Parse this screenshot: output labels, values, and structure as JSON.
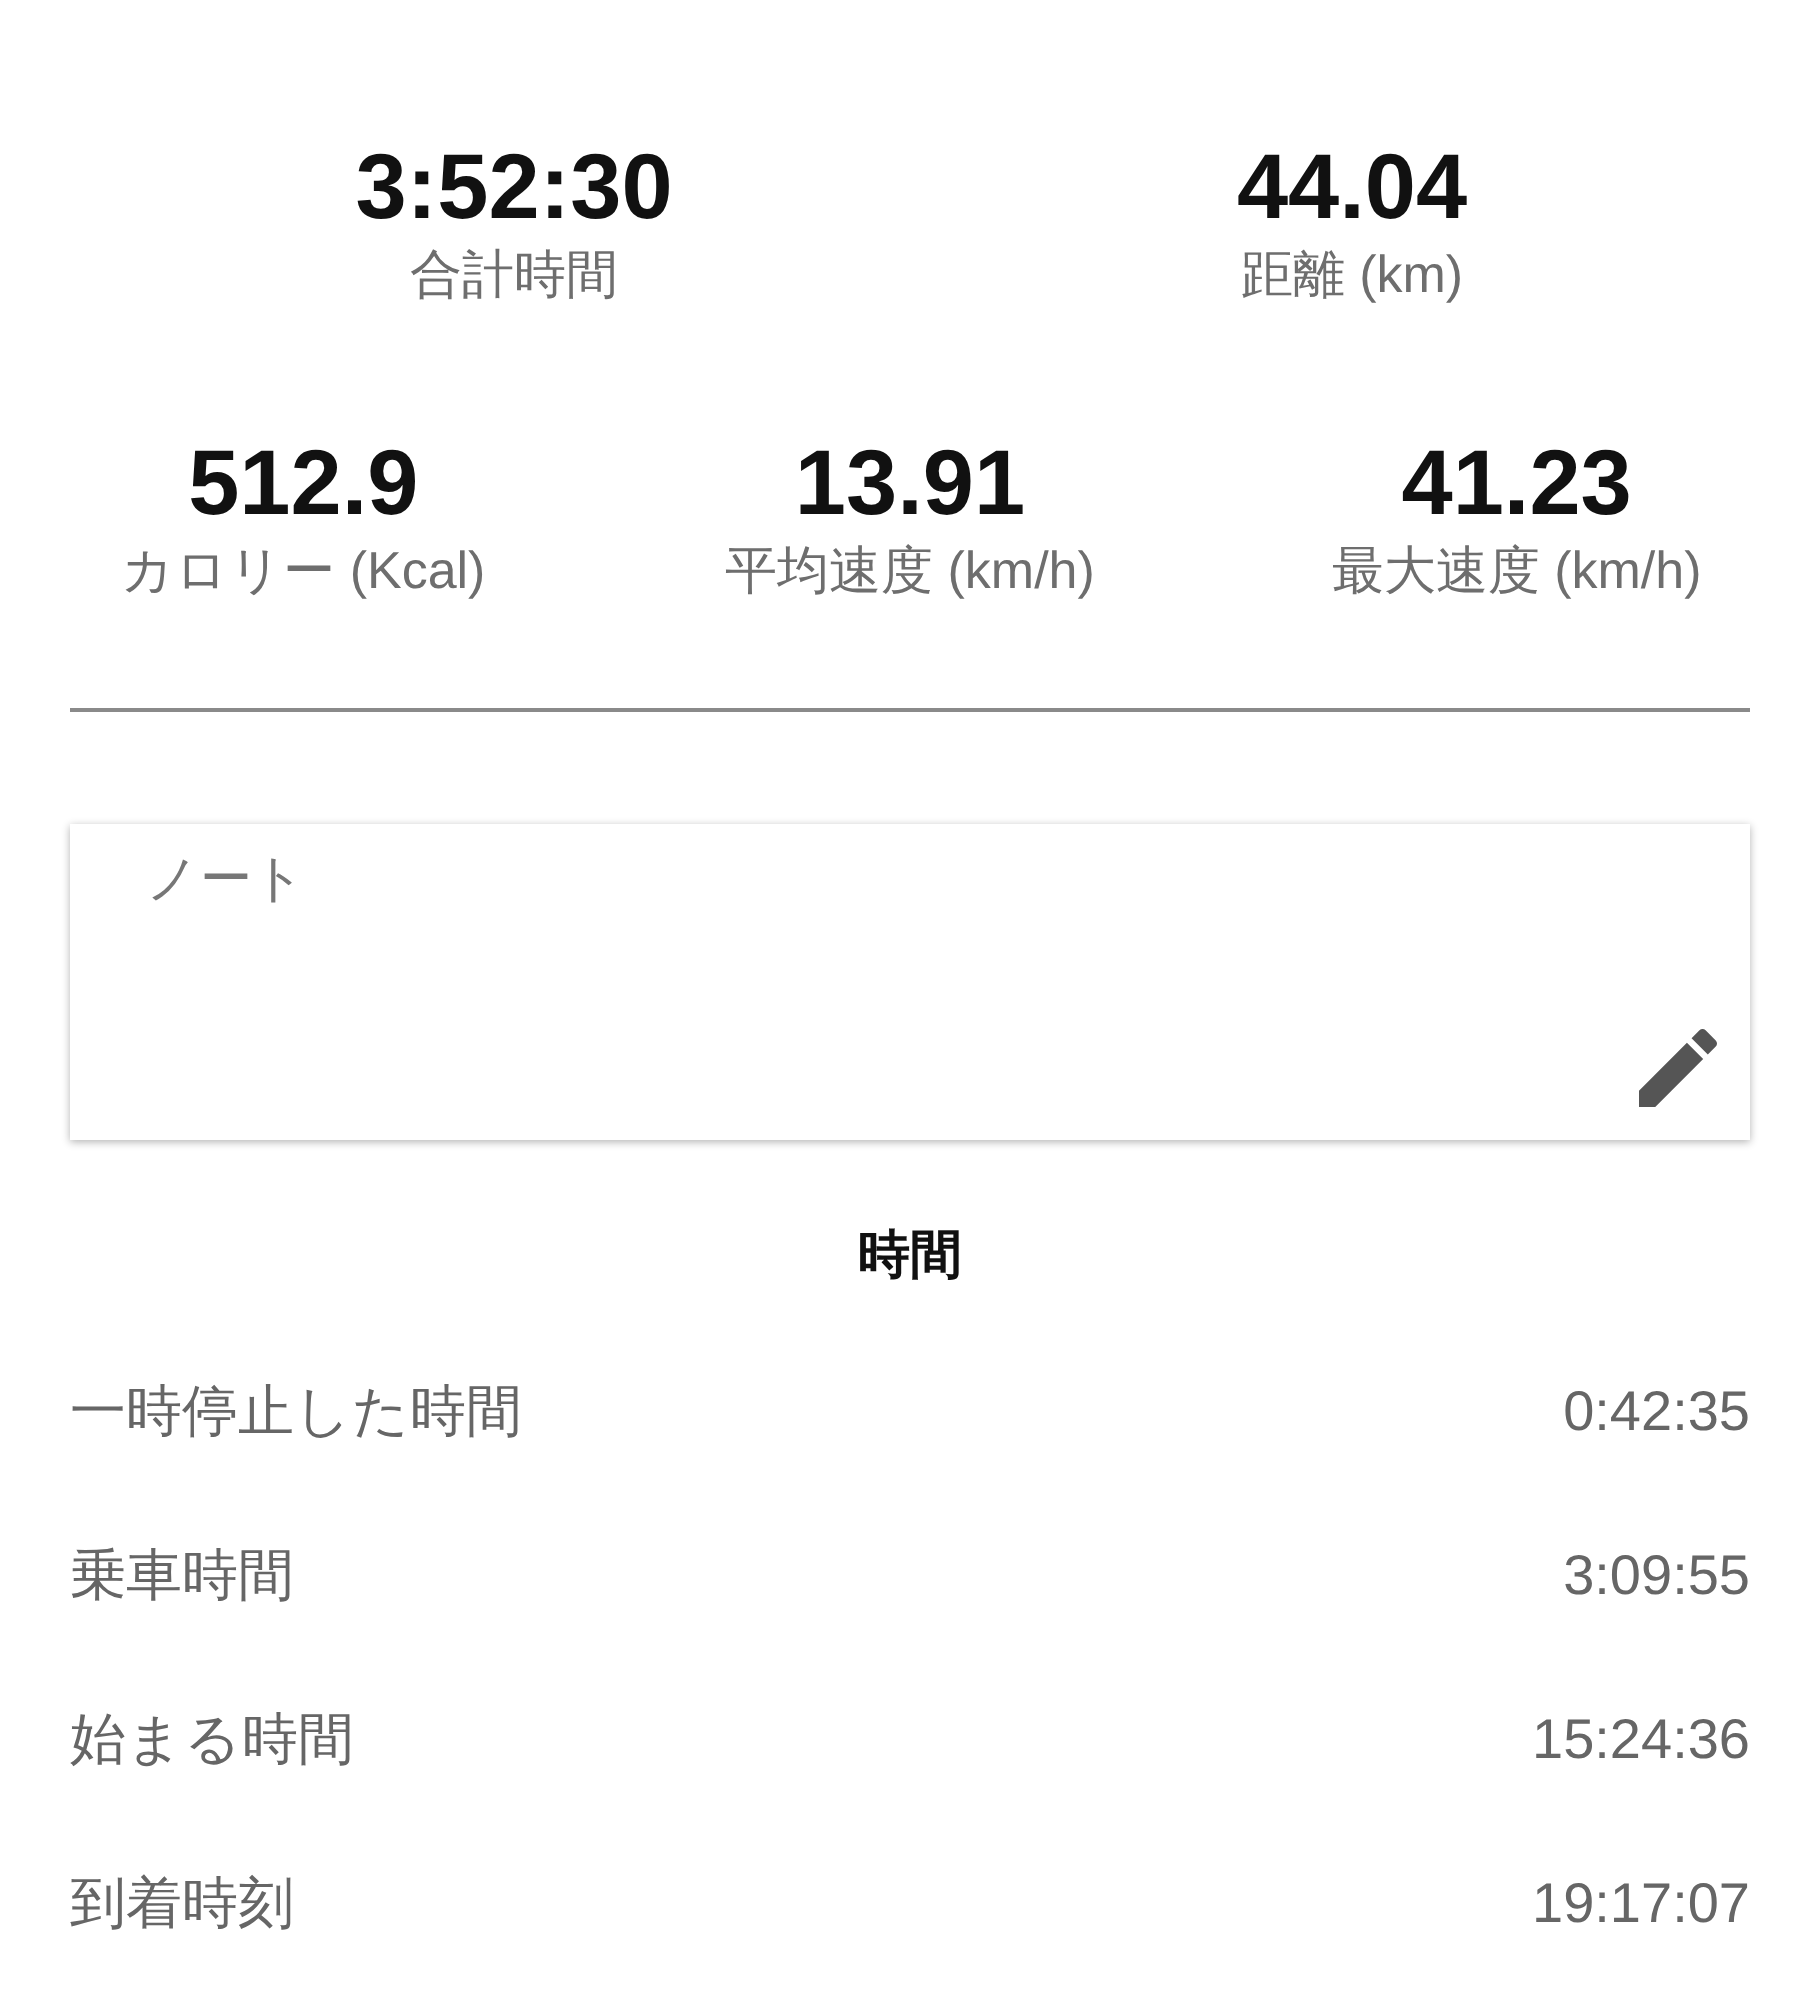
{
  "summary_top": [
    {
      "value": "3:52:30",
      "label": "合計時間"
    },
    {
      "value": "44.04",
      "label": "距離 (km)"
    }
  ],
  "summary_bottom": [
    {
      "value": "512.9",
      "label": "カロリー (Kcal)"
    },
    {
      "value": "13.91",
      "label": "平均速度 (km/h)"
    },
    {
      "value": "41.23",
      "label": "最大速度 (km/h)"
    }
  ],
  "note": {
    "placeholder": "ノート"
  },
  "section": {
    "title": "時間"
  },
  "rows": [
    {
      "label": "一時停止した時間",
      "value": "0:42:35"
    },
    {
      "label": "乗車時間",
      "value": "3:09:55"
    },
    {
      "label": "始まる時間",
      "value": "15:24:36"
    },
    {
      "label": "到着時刻",
      "value": "19:17:07"
    }
  ]
}
